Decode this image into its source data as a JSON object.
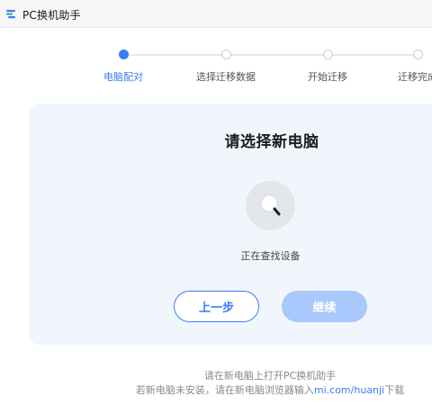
{
  "window": {
    "title": "PC换机助手",
    "icon": "app-logo-icon"
  },
  "stepper": {
    "steps": [
      {
        "label": "电脑配对",
        "active": true
      },
      {
        "label": "选择迁移数据",
        "active": false
      },
      {
        "label": "开始迁移",
        "active": false
      },
      {
        "label": "迁移完成",
        "active": false
      }
    ]
  },
  "card": {
    "title": "请选择新电脑",
    "status": "正在查找设备",
    "prev_button": "上一步",
    "next_button": "继续"
  },
  "footer": {
    "line1": "请在新电脑上打开PC换机助手",
    "line2_prefix": "若新电脑未安装，请在新电脑浏览器输入",
    "line2_link": "mi.com/huanji",
    "line2_suffix": "下载"
  },
  "colors": {
    "accent": "#3b7cf6",
    "disabled_button": "#a9c8fb",
    "card_bg": "#f1f6fd"
  }
}
